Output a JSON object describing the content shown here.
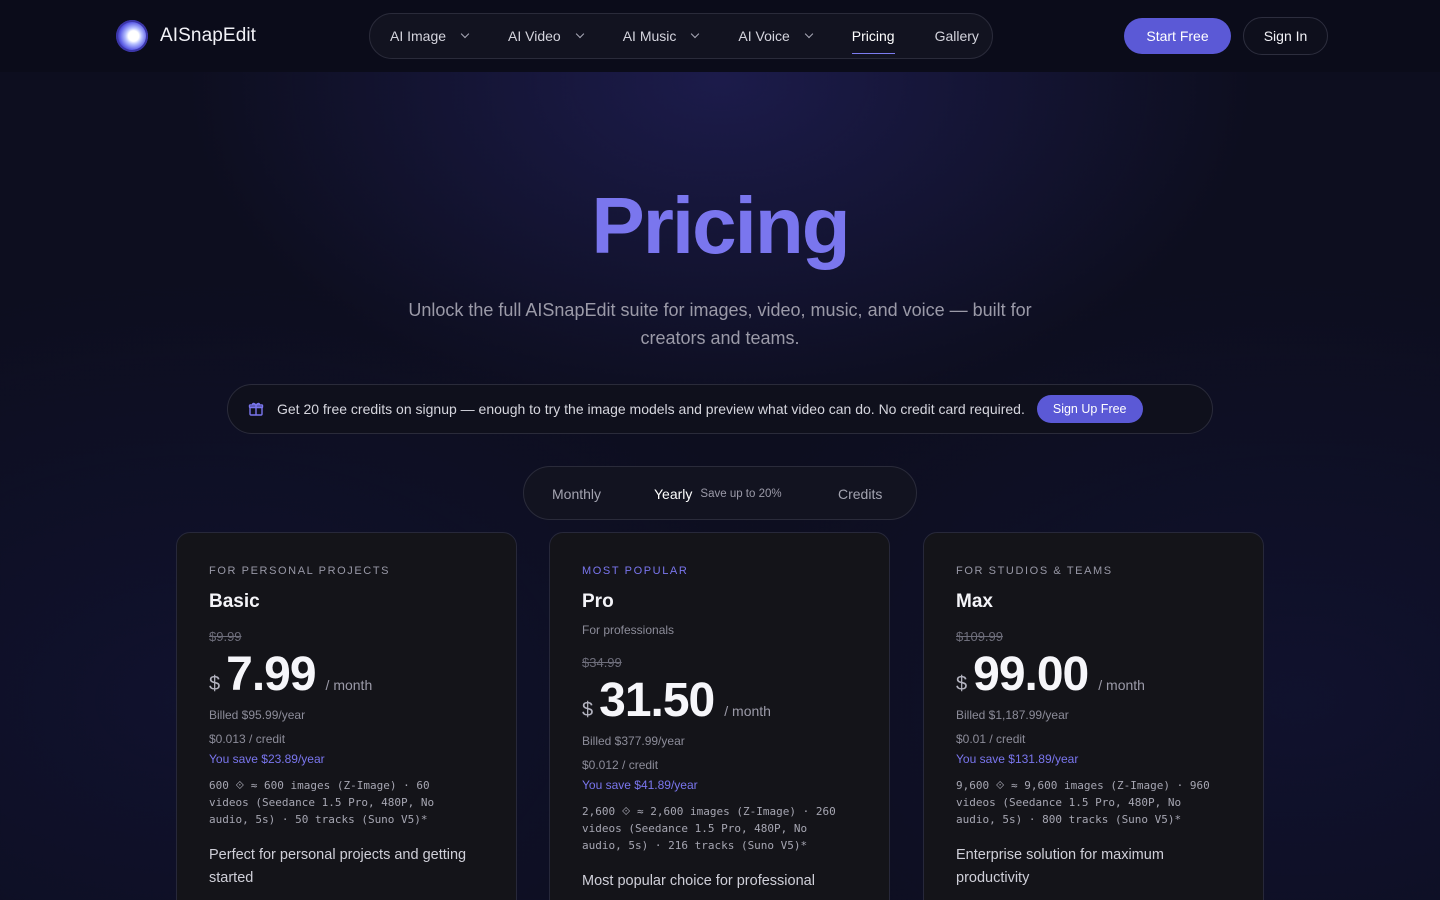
{
  "header": {
    "brand": "AISnapEdit",
    "nav": [
      {
        "label": "AI Image"
      },
      {
        "label": "AI Video"
      },
      {
        "label": "AI Music"
      },
      {
        "label": "AI Voice"
      },
      {
        "label": "Pricing"
      },
      {
        "label": "Gallery"
      }
    ],
    "start_label": "Start Free",
    "signin_label": "Sign In"
  },
  "hero": {
    "title": "Pricing",
    "subtitle": "Unlock the full AISnapEdit suite for images, video, music, and voice — built for creators and teams."
  },
  "promo": {
    "text": "Get 20 free credits on signup — enough to try the image models and preview what video can do. No credit card required.",
    "button": "Sign Up Free"
  },
  "billing_toggle": {
    "monthly": "Monthly",
    "yearly": "Yearly",
    "yearly_note": "Save up to 20%",
    "credits": "Credits",
    "selected": "Yearly"
  },
  "plans": [
    {
      "eyebrow": "FOR PERSONAL PROJECTS",
      "name": "Basic",
      "desc": "",
      "original": "$9.99",
      "currency": "$",
      "price": "7.99",
      "period": "/ month",
      "billed": "Billed $95.99/year",
      "rate": "$0.013 / credit",
      "savings": "You save $23.89/year",
      "credits": "600 ⟐  ≈ 600 images (Z-Image) · 60 videos (Seedance 1.5 Pro, 480P, No audio, 5s) · 50 tracks (Suno V5)*",
      "blurb": "Perfect for personal projects and getting started"
    },
    {
      "eyebrow": "MOST POPULAR",
      "name": "Pro",
      "desc": "For professionals",
      "original": "$34.99",
      "currency": "$",
      "price": "31.50",
      "period": "/ month",
      "billed": "Billed $377.99/year",
      "rate": "$0.012 / credit",
      "savings": "You save $41.89/year",
      "credits": "2,600 ⟐  ≈ 2,600 images (Z-Image) · 260 videos (Seedance 1.5 Pro, 480P, No audio, 5s) · 216 tracks (Suno V5)*",
      "blurb": "Most popular choice for professional"
    },
    {
      "eyebrow": "FOR STUDIOS & TEAMS",
      "name": "Max",
      "desc": "",
      "original": "$109.99",
      "currency": "$",
      "price": "99.00",
      "period": "/ month",
      "billed": "Billed $1,187.99/year",
      "rate": "$0.01 / credit",
      "savings": "You save $131.89/year",
      "credits": "9,600 ⟐  ≈ 9,600 images (Z-Image) · 960 videos (Seedance 1.5 Pro, 480P, No audio, 5s) · 800 tracks (Suno V5)*",
      "blurb": "Enterprise solution for maximum productivity"
    }
  ]
}
